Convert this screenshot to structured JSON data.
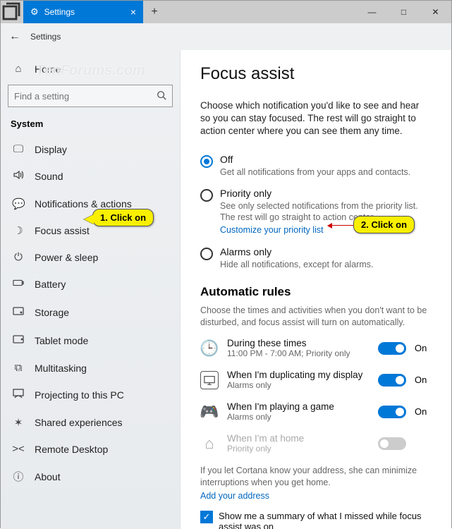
{
  "titlebar": {
    "tab_label": "Settings",
    "new_tab": "+",
    "close_tab": "×",
    "min": "—",
    "max": "□",
    "close": "✕"
  },
  "header": {
    "back": "←",
    "title": "Settings"
  },
  "sidebar": {
    "home": "Home",
    "search_placeholder": "Find a setting",
    "section": "System",
    "items": [
      {
        "icon": "display",
        "label": "Display"
      },
      {
        "icon": "sound",
        "label": "Sound"
      },
      {
        "icon": "notifications",
        "label": "Notifications & actions"
      },
      {
        "icon": "focus",
        "label": "Focus assist"
      },
      {
        "icon": "power",
        "label": "Power & sleep"
      },
      {
        "icon": "battery",
        "label": "Battery"
      },
      {
        "icon": "storage",
        "label": "Storage"
      },
      {
        "icon": "tablet",
        "label": "Tablet mode"
      },
      {
        "icon": "multitask",
        "label": "Multitasking"
      },
      {
        "icon": "projecting",
        "label": "Projecting to this PC"
      },
      {
        "icon": "shared",
        "label": "Shared experiences"
      },
      {
        "icon": "remote",
        "label": "Remote Desktop"
      },
      {
        "icon": "about",
        "label": "About"
      }
    ]
  },
  "content": {
    "title": "Focus assist",
    "intro": "Choose which notification you'd like to see and hear so you can stay focused. The rest will go straight to action center where you can see them any time.",
    "radios": [
      {
        "label": "Off",
        "sub": "Get all notifications from your apps and contacts.",
        "checked": true
      },
      {
        "label": "Priority only",
        "sub": "See only selected notifications from the priority list. The rest will go straight to action center.",
        "checked": false,
        "link": "Customize your priority list"
      },
      {
        "label": "Alarms only",
        "sub": "Hide all notifications, except for alarms.",
        "checked": false
      }
    ],
    "rules_heading": "Automatic rules",
    "rules_desc": "Choose the times and activities when you don't want to be disturbed, and focus assist will turn on automatically.",
    "rules": [
      {
        "icon": "clock",
        "title": "During these times",
        "sub": "11:00 PM - 7:00 AM; Priority only",
        "on": true,
        "state": "On"
      },
      {
        "icon": "monitor",
        "title": "When I'm duplicating my display",
        "sub": "Alarms only",
        "on": true,
        "state": "On"
      },
      {
        "icon": "game",
        "title": "When I'm playing a game",
        "sub": "Alarms only",
        "on": true,
        "state": "On"
      },
      {
        "icon": "home",
        "title": "When I'm at home",
        "sub": "Priority only",
        "on": false,
        "state": "",
        "disabled": true
      }
    ],
    "cortana_note": "If you let Cortana know your address, she can minimize interruptions when you get home.",
    "cortana_link": "Add your address",
    "summary_checkbox": "Show me a summary of what I missed while focus assist was on"
  },
  "callouts": {
    "c1": "1. Click on",
    "c2": "2. Click on"
  },
  "watermark": "TenForums.com"
}
